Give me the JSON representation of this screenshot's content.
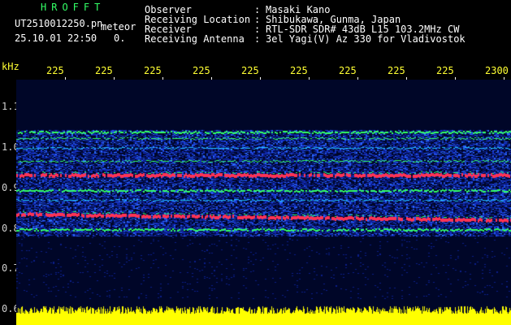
{
  "header": {
    "app_title": "HROFFT",
    "file_name": "UT2510012250.pn",
    "mode": "meteor",
    "datetime": "25.10.01 22:50",
    "count": "0.",
    "info_labels": [
      "Observer",
      "Receiving Location",
      "Receiver",
      "Receiving Antenna"
    ],
    "info_colons": [
      ":",
      ":",
      ":",
      ":"
    ],
    "info_values": [
      "Masaki Kano",
      "Shibukawa, Gunma, Japan",
      "RTL-SDR SDR# 43dB L15 103.2MHz CW",
      "3el Yagi(V) Az 330 for Vladivostok"
    ]
  },
  "axes": {
    "y_unit": "kHz",
    "y_ticks": [
      "1.1",
      "1.0",
      "0.9",
      "0.8",
      "0.7",
      "0.6"
    ],
    "x_ticks": [
      "225",
      "225",
      "225",
      "225",
      "225",
      "225",
      "225",
      "225",
      "225",
      "2300"
    ]
  },
  "colors": {
    "background": "#000000",
    "plot_background": "#000628",
    "noise_blue": "#1a3dff",
    "trace_green": "#33ff66",
    "trace_red": "#ff3355",
    "amplitude_yellow": "#ffff00",
    "label_green": "#33ff66",
    "label_yellow": "#ffff33"
  }
}
